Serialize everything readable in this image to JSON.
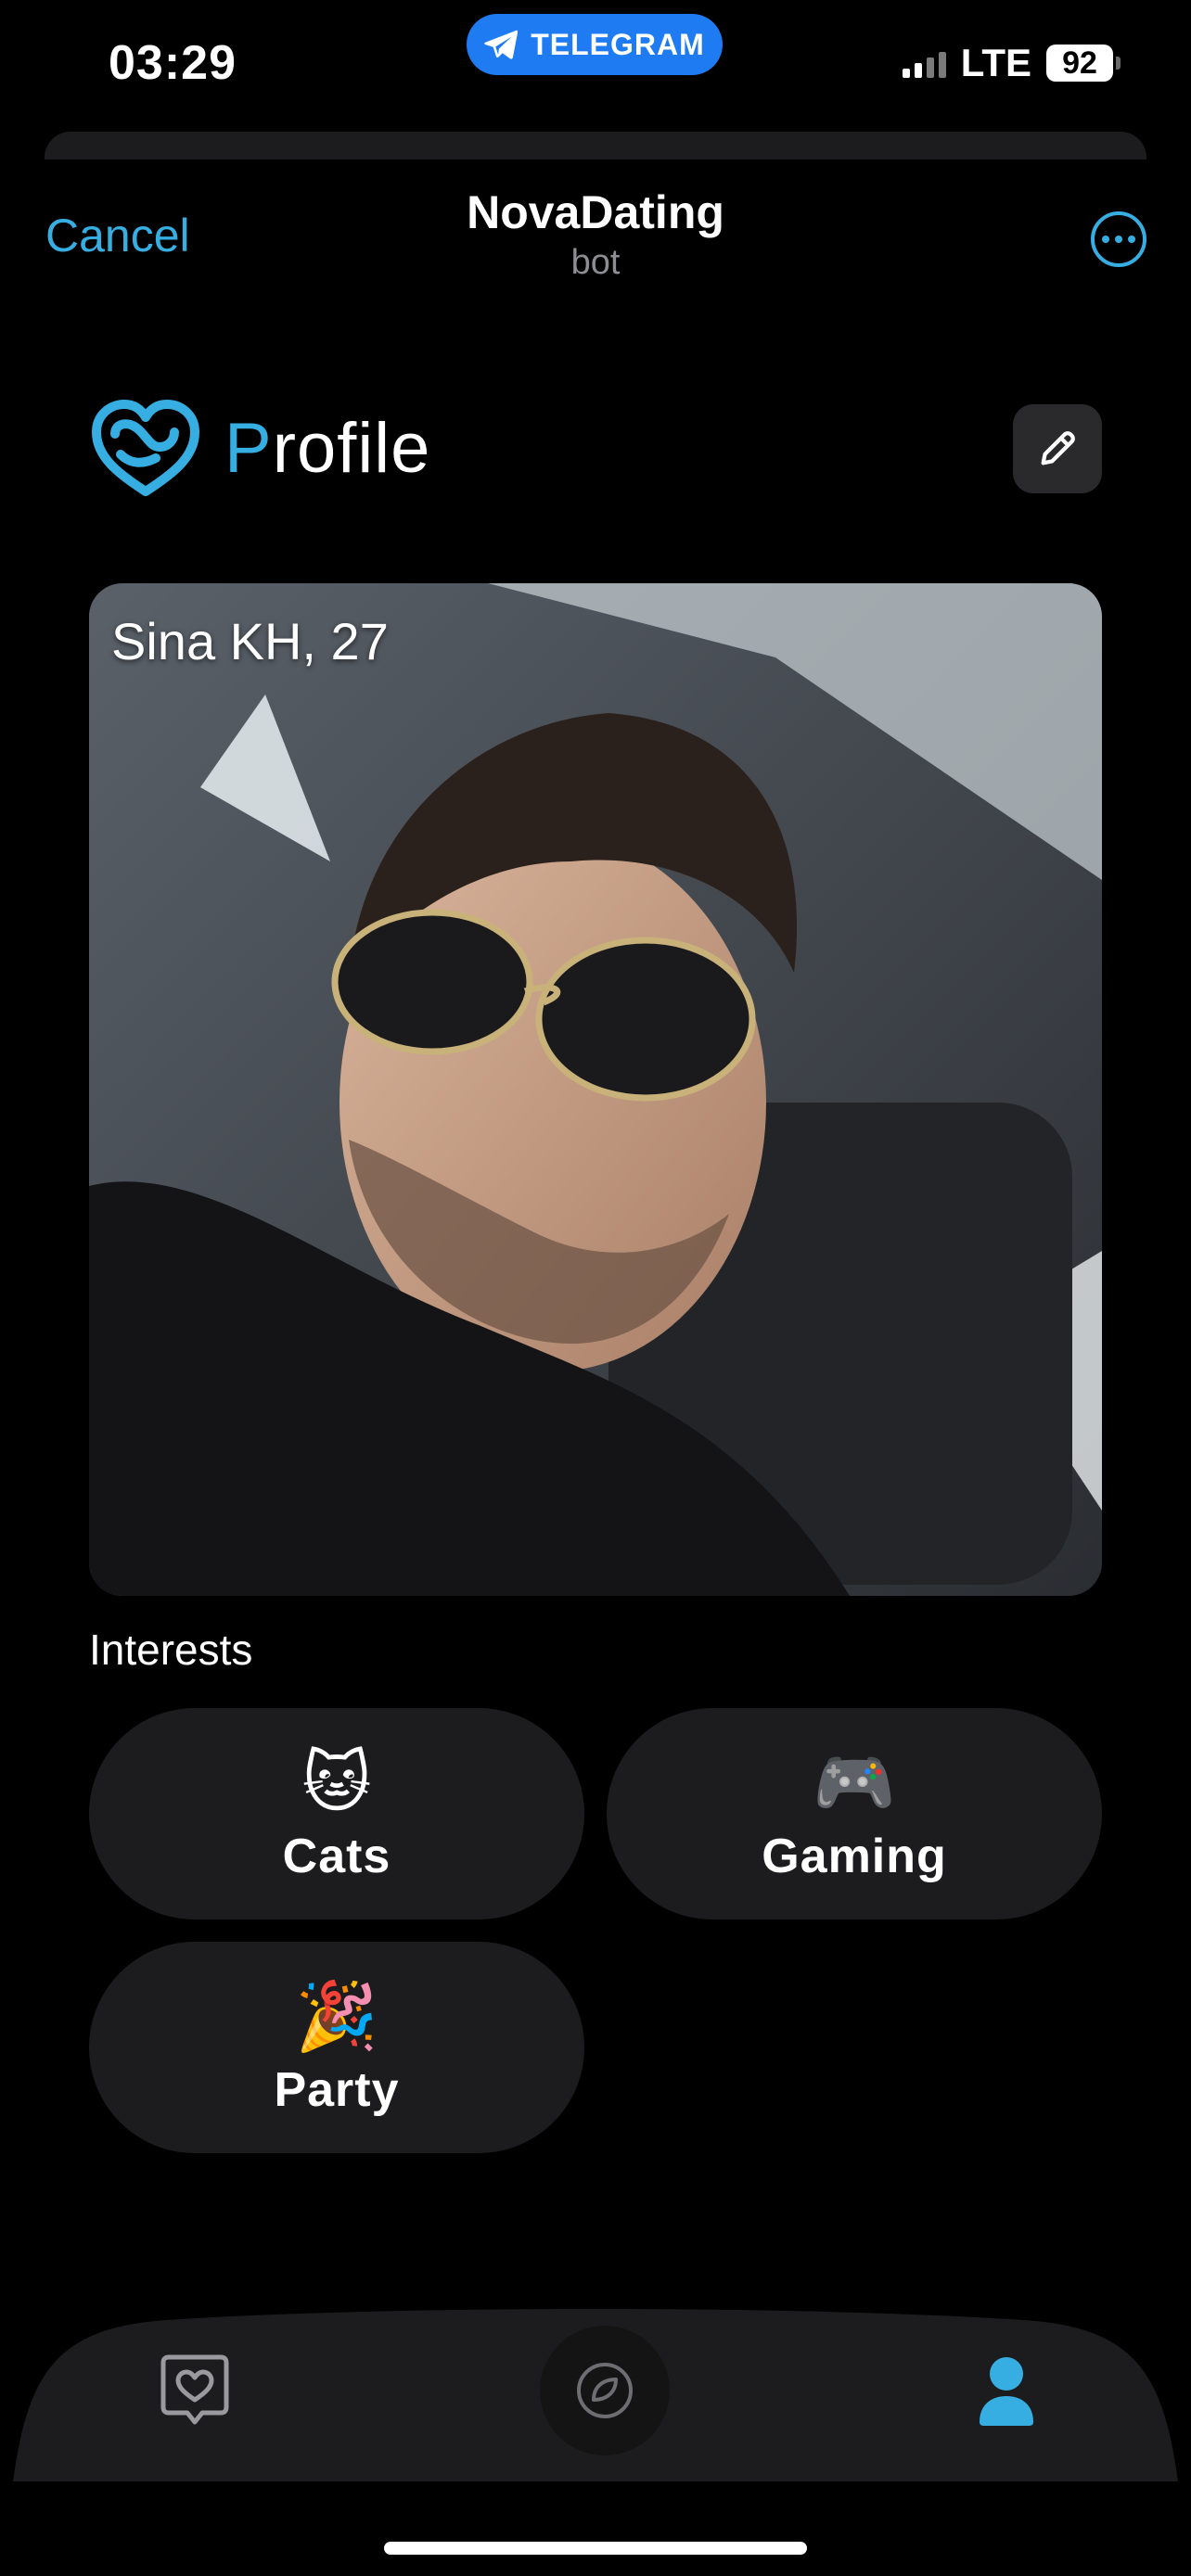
{
  "status_bar": {
    "time": "03:29",
    "app_pill_label": "TELEGRAM",
    "network": "LTE",
    "battery": "92"
  },
  "header": {
    "cancel_label": "Cancel",
    "title": "NovaDating",
    "subtitle": "bot"
  },
  "profile": {
    "heading_first": "P",
    "heading_rest": "rofile",
    "name_age": "Sina KH, 27"
  },
  "interests": {
    "label": "Interests",
    "items": [
      {
        "emoji": "🐱",
        "label": "Cats"
      },
      {
        "emoji": "🎮",
        "label": "Gaming"
      },
      {
        "emoji": "🎉",
        "label": "Party"
      }
    ]
  },
  "colors": {
    "accent": "#37aee2",
    "telegram_blue": "#1e7bf2",
    "background": "#000000",
    "surface": "#1c1c1e"
  },
  "icons": {
    "telegram": "telegram-plane-icon",
    "more": "more-horizontal-icon",
    "edit": "pencil-icon",
    "tab_matches": "heart-chat-icon",
    "tab_discover": "nova-circle-icon",
    "tab_profile": "user-icon"
  }
}
